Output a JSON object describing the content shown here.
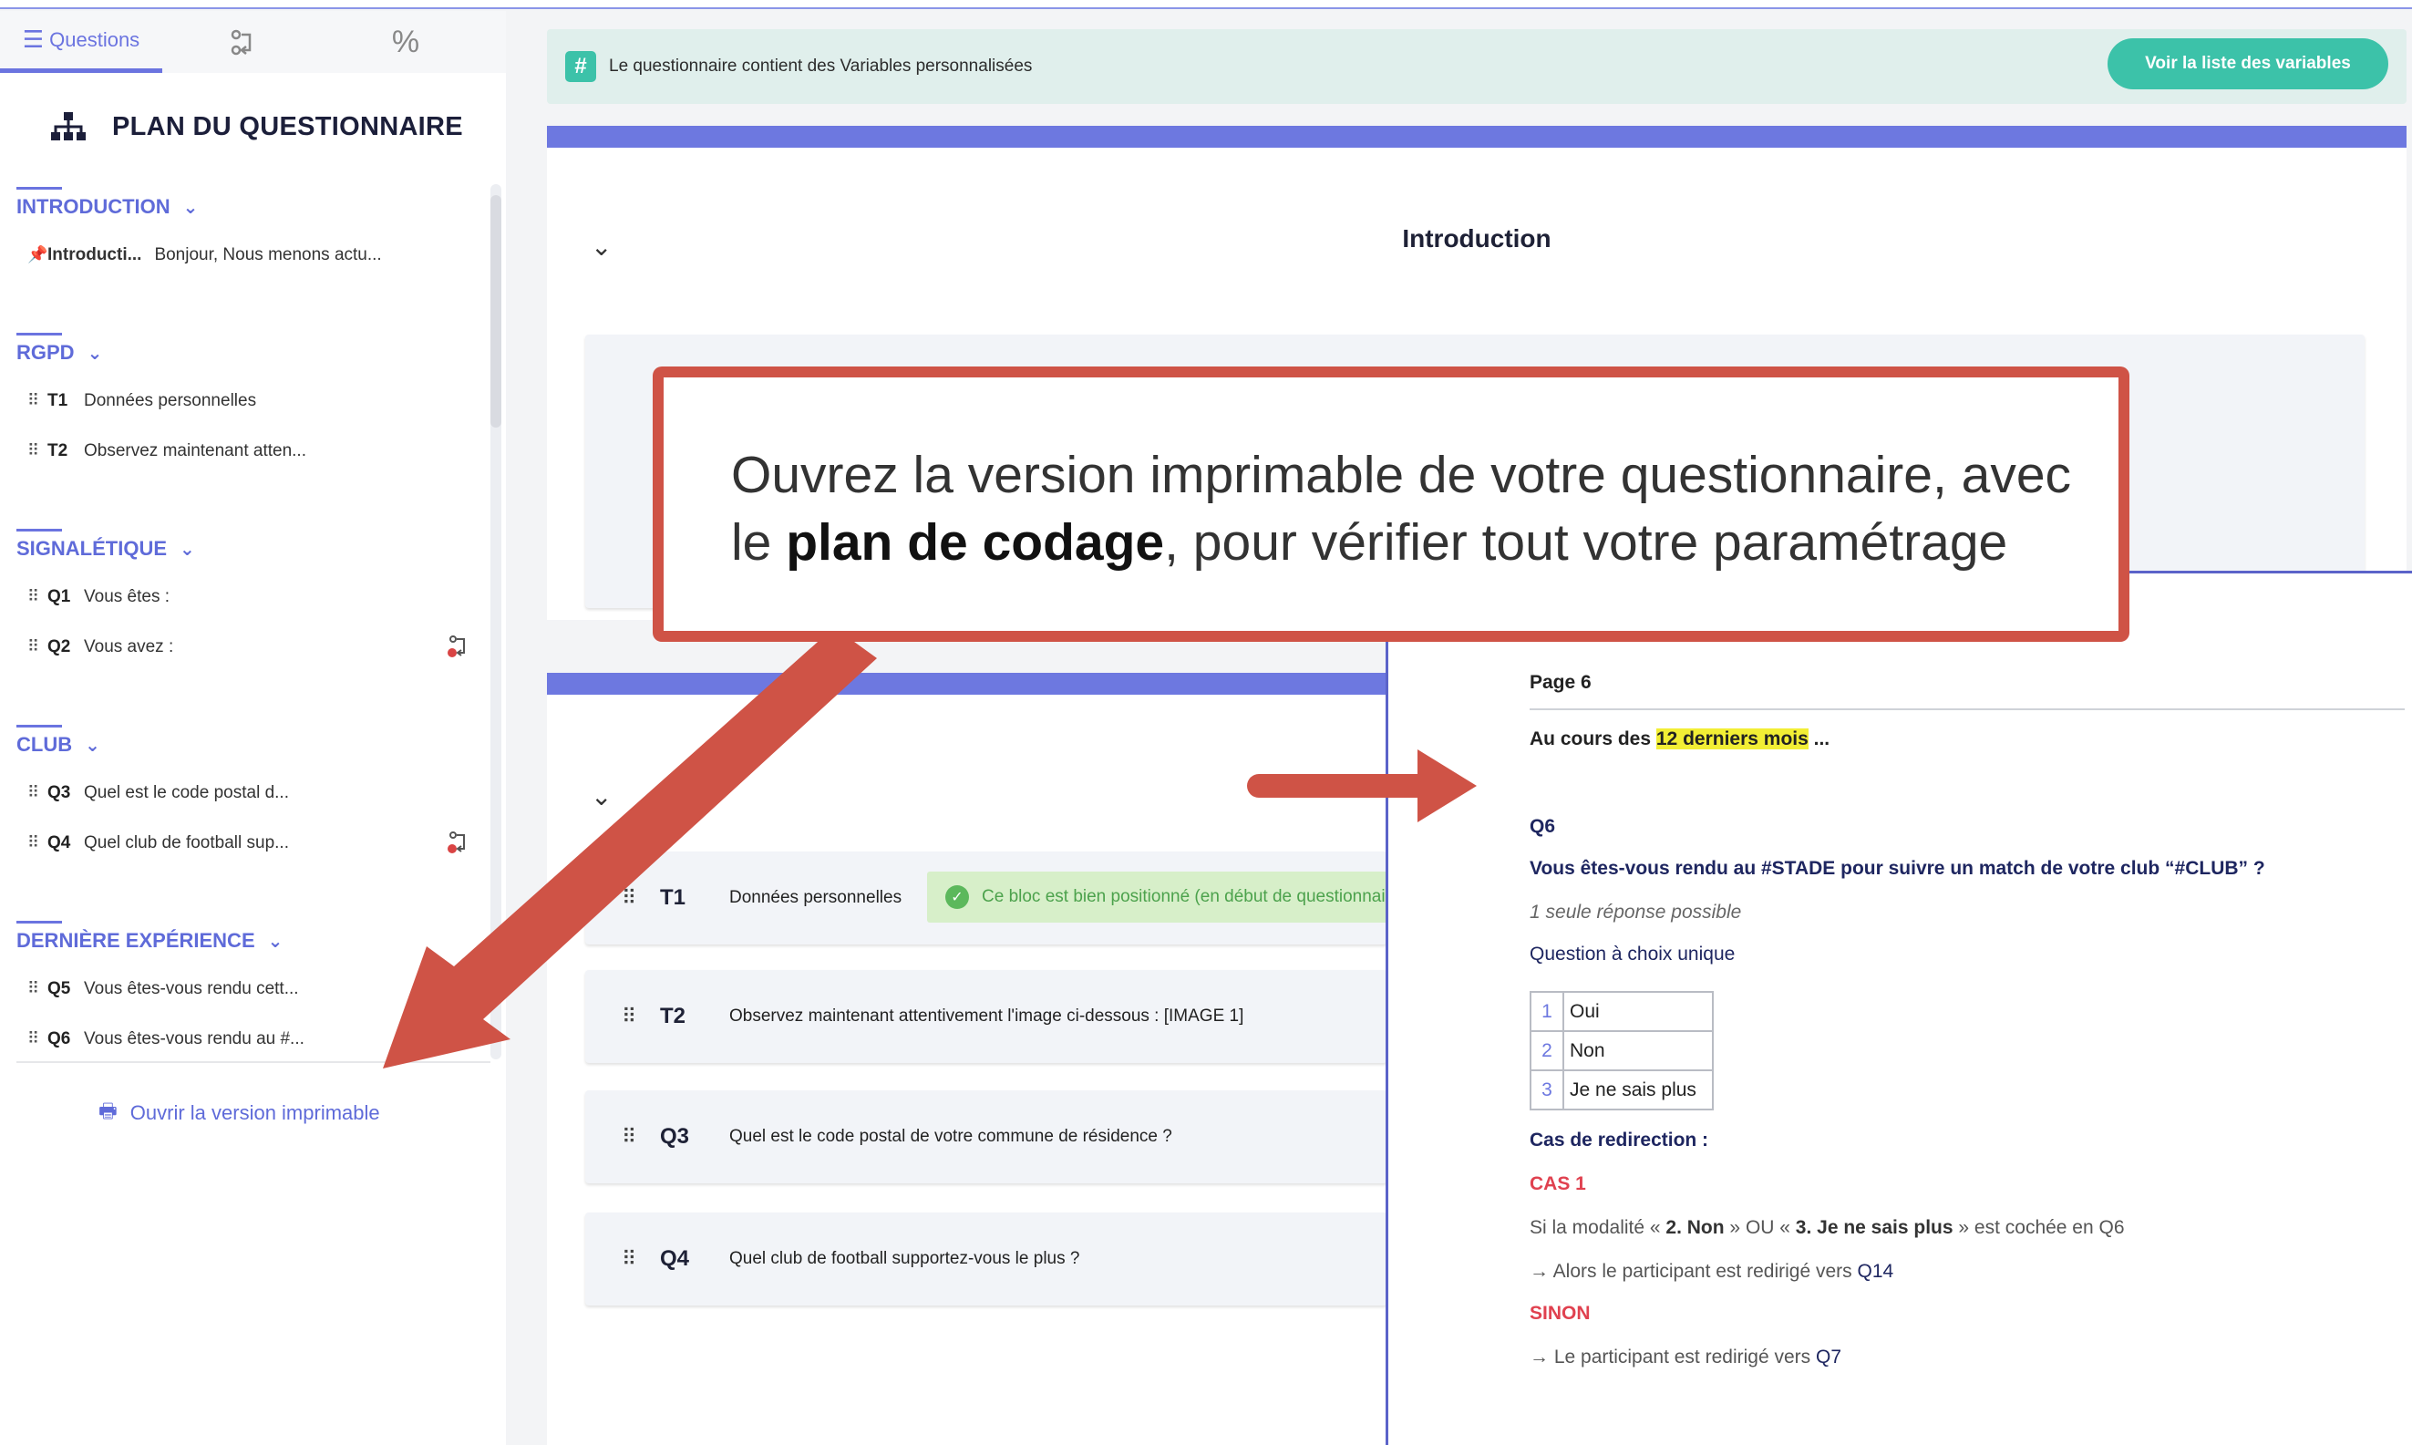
{
  "sidebar": {
    "tabs": [
      {
        "label": "Questions",
        "icon": "list-icon"
      },
      {
        "label": "",
        "icon": "logic-icon"
      },
      {
        "label": "%",
        "icon": "percent-icon"
      }
    ],
    "title": "PLAN DU QUESTIONNAIRE",
    "sections": [
      {
        "name": "INTRODUCTION",
        "items": [
          {
            "code": "Introducti...",
            "label": "Bonjour, Nous menons actu...",
            "type": "pin"
          }
        ]
      },
      {
        "name": "RGPD",
        "items": [
          {
            "code": "T1",
            "label": "Données personnelles"
          },
          {
            "code": "T2",
            "label": "Observez maintenant atten..."
          }
        ]
      },
      {
        "name": "SIGNALÉTIQUE",
        "items": [
          {
            "code": "Q1",
            "label": "Vous êtes :"
          },
          {
            "code": "Q2",
            "label": "Vous avez :",
            "logic": true
          }
        ]
      },
      {
        "name": "CLUB",
        "items": [
          {
            "code": "Q3",
            "label": "Quel est le code postal d..."
          },
          {
            "code": "Q4",
            "label": "Quel club de football sup...",
            "logic": true
          }
        ]
      },
      {
        "name": "DERNIÈRE EXPÉRIENCE",
        "items": [
          {
            "code": "Q5",
            "label": "Vous êtes-vous rendu cett..."
          },
          {
            "code": "Q6",
            "label": "Vous êtes-vous rendu au #..."
          }
        ]
      }
    ],
    "print_link": "Ouvrir la version imprimable"
  },
  "banner": {
    "text": "Le questionnaire contient des Variables personnalisées",
    "button": "Voir la liste des variables",
    "hash": "#"
  },
  "block1": {
    "title": "Introduction"
  },
  "block2": {
    "rows": [
      {
        "code": "T1",
        "text": "Données personnelles",
        "badge": "Ce bloc est bien positionné (en début de questionnaire)"
      },
      {
        "code": "T2",
        "text": "Observez maintenant attentivement l'image ci-dessous : [IMAGE 1]"
      },
      {
        "code": "Q3",
        "text": "Quel est le code postal de votre commune de résidence ?"
      },
      {
        "code": "Q4",
        "text": "Quel club de football supportez-vous le plus ?"
      }
    ]
  },
  "preview": {
    "page": "Page 6",
    "intro_before": "Au cours des ",
    "intro_highlight": "12 derniers mois",
    "intro_after": " ...",
    "qcode": "Q6",
    "qtitle": "Vous êtes-vous rendu au #STADE pour suivre un match de votre club “#CLUB” ?",
    "hint": "1 seule réponse possible",
    "qtype": "Question à choix unique",
    "options": [
      {
        "n": "1",
        "label": "Oui"
      },
      {
        "n": "2",
        "label": "Non"
      },
      {
        "n": "3",
        "label": "Je ne sais plus"
      }
    ],
    "cas_title": "Cas de redirection :",
    "cas1": "CAS 1",
    "cas1_prefix": "Si la modalité « ",
    "cas1_opt1": "2. Non",
    "cas1_mid": " » OU « ",
    "cas1_opt2": "3. Je ne sais plus",
    "cas1_suffix": " » est cochée en Q6",
    "cas1_then_prefix": "→ Alors le participant est redirigé vers ",
    "cas1_then_target": "Q14",
    "sinon": "SINON",
    "sinon_then_prefix": "→ Le participant est redirigé vers ",
    "sinon_then_target": "Q7"
  },
  "callout": {
    "line_prefix": "Ouvrez la version imprimable de votre questionnaire, avec le ",
    "bold": "plan de codage",
    "line_suffix": ", pour vérifier tout votre paramétrage"
  },
  "colors": {
    "accent": "#6b74e0",
    "teal": "#3cc2a9",
    "callout_red": "#cf5346",
    "redirect_red": "#e0414f",
    "highlight": "#f2ee35"
  }
}
